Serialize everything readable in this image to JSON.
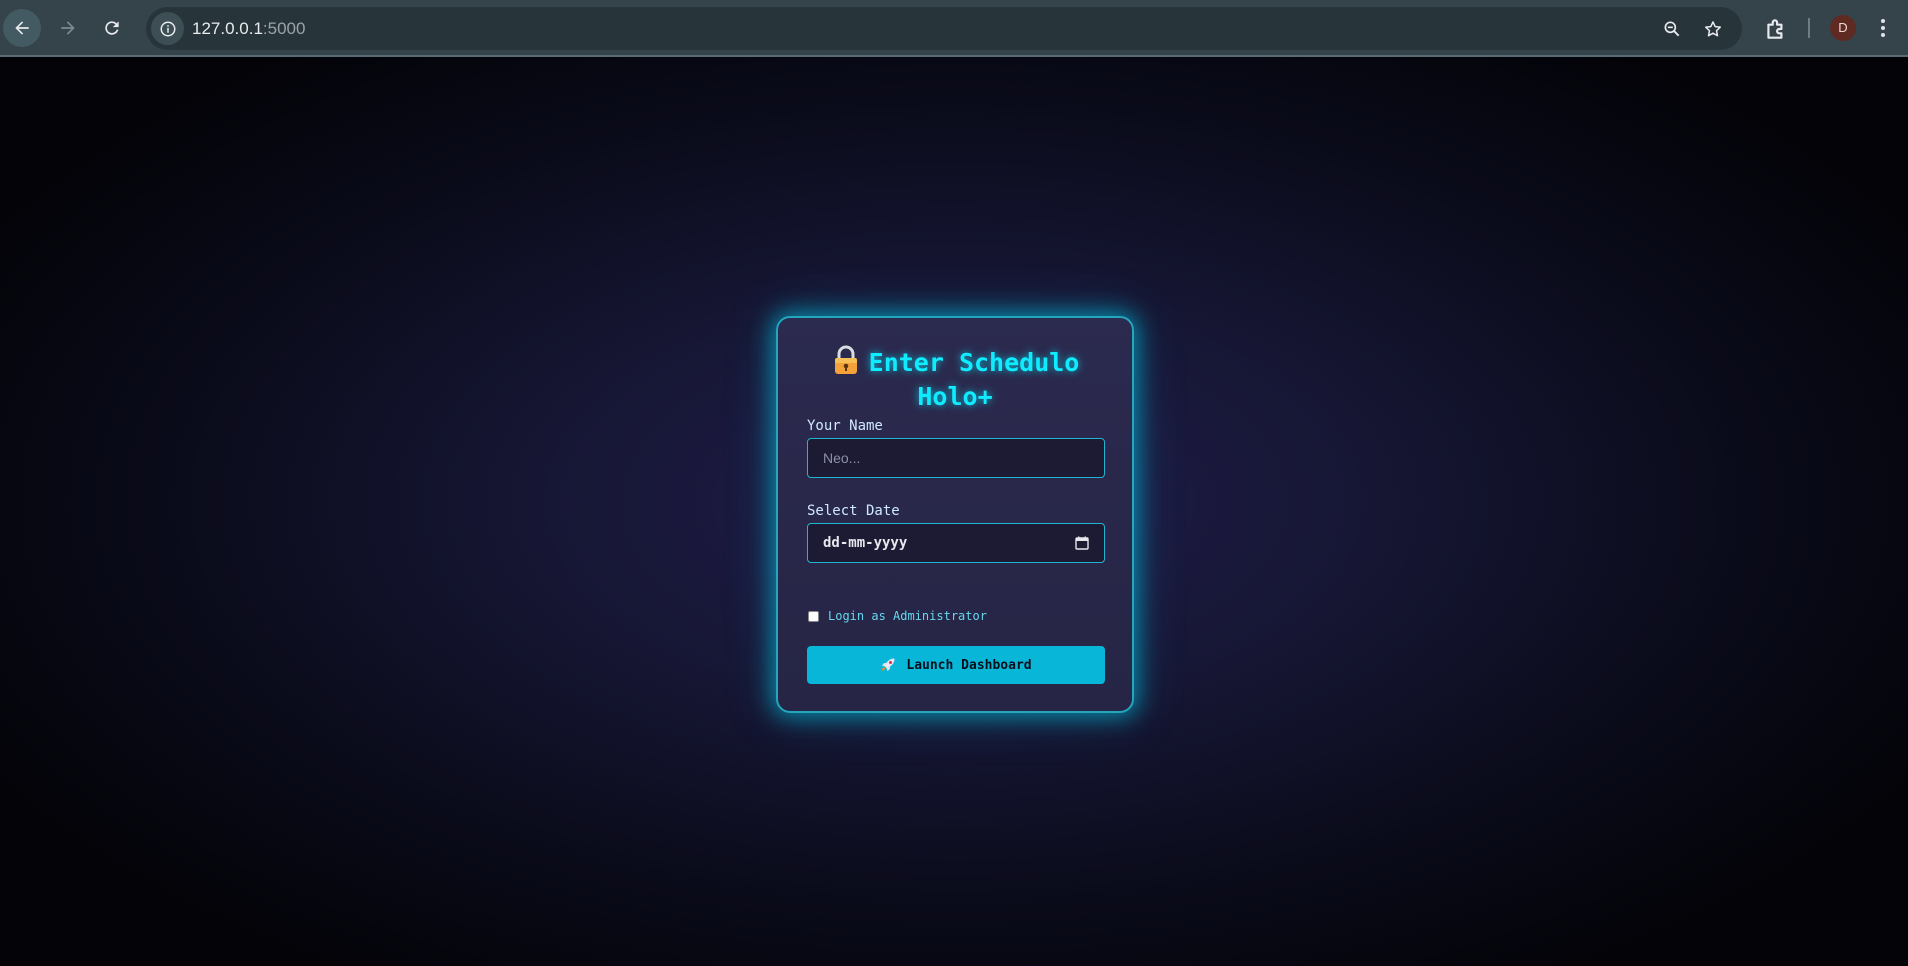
{
  "browser": {
    "url_host": "127.0.0.1",
    "url_port": ":5000",
    "profile_initial": "D"
  },
  "login": {
    "title_line1": "Enter Schedulo",
    "title_line2": "Holo+",
    "name_label": "Your Name",
    "name_placeholder": "Neo...",
    "date_label": "Select Date",
    "date_placeholder": "dd-mm-yyyy",
    "admin_checkbox_label": "Login as Administrator",
    "launch_button_label": "Launch Dashboard"
  },
  "icons": [
    "back-icon",
    "forward-icon",
    "reload-icon",
    "info-icon",
    "zoom-out-icon",
    "star-icon",
    "extensions-icon",
    "menu-icon",
    "lock-icon",
    "calendar-icon",
    "rocket-icon"
  ],
  "colors": {
    "accent": "#10ecff",
    "button": "#08b6d8",
    "card_border": "#24a6bd"
  }
}
